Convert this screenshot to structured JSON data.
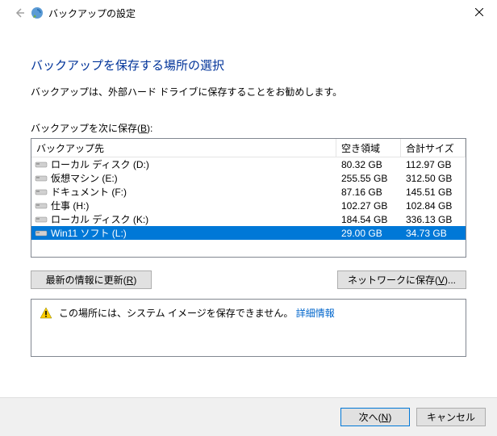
{
  "window": {
    "title": "バックアップの設定"
  },
  "heading": "バックアップを保存する場所の選択",
  "subtext": "バックアップは、外部ハード ドライブに保存することをお勧めします。",
  "list_label_prefix": "バックアップを次に保存(",
  "list_label_key": "B",
  "list_label_suffix": "):",
  "columns": {
    "dest": "バックアップ先",
    "free": "空き領域",
    "total": "合計サイズ"
  },
  "drives": [
    {
      "name": "ローカル ディスク (D:)",
      "free": "80.32 GB",
      "total": "112.97 GB",
      "selected": false
    },
    {
      "name": "仮想マシン (E:)",
      "free": "255.55 GB",
      "total": "312.50 GB",
      "selected": false
    },
    {
      "name": "ドキュメント (F:)",
      "free": "87.16 GB",
      "total": "145.51 GB",
      "selected": false
    },
    {
      "name": "仕事 (H:)",
      "free": "102.27 GB",
      "total": "102.84 GB",
      "selected": false
    },
    {
      "name": "ローカル ディスク (K:)",
      "free": "184.54 GB",
      "total": "336.13 GB",
      "selected": false
    },
    {
      "name": "Win11 ソフト (L:)",
      "free": "29.00 GB",
      "total": "34.73 GB",
      "selected": true
    }
  ],
  "buttons": {
    "refresh_prefix": "最新の情報に更新(",
    "refresh_key": "R",
    "refresh_suffix": ")",
    "network_prefix": "ネットワークに保存(",
    "network_key": "V",
    "network_suffix": ")...",
    "next_prefix": "次へ(",
    "next_key": "N",
    "next_suffix": ")",
    "cancel": "キャンセル"
  },
  "warning": {
    "text": "この場所には、システム イメージを保存できません。",
    "link": "詳細情報"
  }
}
